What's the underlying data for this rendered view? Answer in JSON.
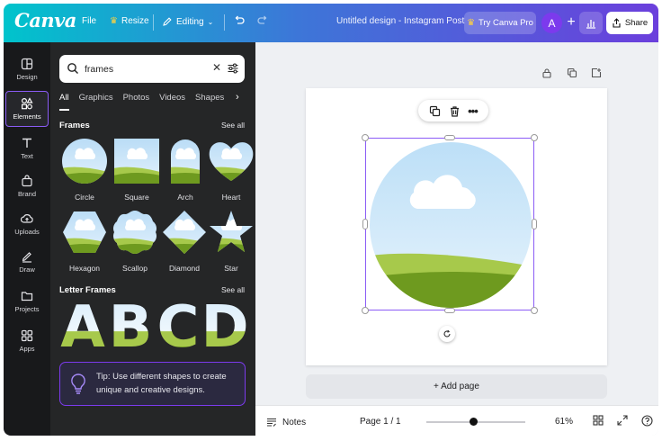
{
  "app": {
    "logo": "Canva"
  },
  "topbar": {
    "file": "File",
    "resize": "Resize",
    "editing": "Editing",
    "title": "Untitled design - Instagram Post",
    "try_pro": "Try Canva Pro",
    "avatar_initial": "A",
    "share": "Share"
  },
  "rail": [
    {
      "label": "Design",
      "icon": "design-icon"
    },
    {
      "label": "Elements",
      "icon": "elements-icon",
      "active": true
    },
    {
      "label": "Text",
      "icon": "text-icon"
    },
    {
      "label": "Brand",
      "icon": "brand-icon"
    },
    {
      "label": "Uploads",
      "icon": "uploads-icon"
    },
    {
      "label": "Draw",
      "icon": "draw-icon"
    },
    {
      "label": "Projects",
      "icon": "projects-icon"
    },
    {
      "label": "Apps",
      "icon": "apps-icon"
    }
  ],
  "panel": {
    "search_value": "frames",
    "tabs": [
      "All",
      "Graphics",
      "Photos",
      "Videos",
      "Shapes"
    ],
    "frames_title": "Frames",
    "frames_see_all": "See all",
    "frames": [
      "Circle",
      "Square",
      "Arch",
      "Heart",
      "Hexagon",
      "Scallop",
      "Diamond",
      "Star"
    ],
    "letter_frames_title": "Letter Frames",
    "letter_frames_see_all": "See all",
    "letters": [
      "A",
      "B",
      "C",
      "D"
    ],
    "tip": "Tip: Use different shapes to create unique and creative designs."
  },
  "canvas": {
    "add_page": "+ Add page"
  },
  "bottombar": {
    "notes": "Notes",
    "page": "Page 1 / 1",
    "zoom": "61%",
    "zoom_fraction": 0.48
  },
  "colors": {
    "accent": "#8b5cf6",
    "sky": "#cfe8fb",
    "grass_light": "#a7c94b",
    "grass_dark": "#6e9a1f"
  }
}
